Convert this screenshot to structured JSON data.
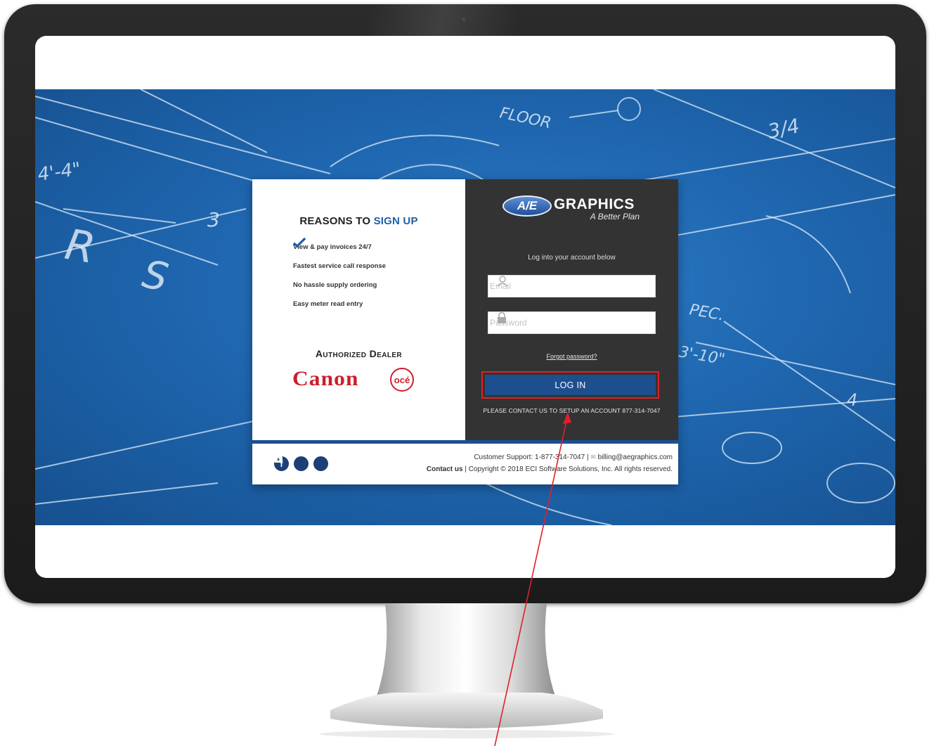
{
  "reasons": {
    "title_prefix": "REASONS TO",
    "title_accent": "SIGN UP",
    "items": [
      "View & pay invoices 24/7",
      "Fastest service call response",
      "No hassle supply ordering",
      "Easy meter read entry"
    ]
  },
  "dealer": {
    "title": "Authorized Dealer",
    "brands": [
      "Canon",
      "océ"
    ]
  },
  "brand": {
    "badge": "A/E",
    "name": "GRAPHICS",
    "tagline": "A Better Plan"
  },
  "login": {
    "prompt": "Log into your account below",
    "email_placeholder": "Email",
    "password_placeholder": "Password",
    "forgot": "Forgot password?",
    "button": "LOG IN",
    "contact_note": "PLEASE CONTACT US TO SETUP AN ACCOUNT 877-314-7047"
  },
  "footer": {
    "support": "Customer Support: 1-877-314-7047 |",
    "email": "billing@aegraphics.com",
    "contact_link": "Contact us",
    "copyright": "| Copyright © 2018 ECI Software Solutions, Inc. All rights reserved.",
    "social_icons": [
      "facebook-icon",
      "twitter-icon",
      "youtube-icon"
    ]
  },
  "colors": {
    "accent_blue": "#1d4f8f",
    "highlight_red": "#e0202a",
    "brand_red": "#cc1e2b",
    "panel_dark": "#333333"
  }
}
